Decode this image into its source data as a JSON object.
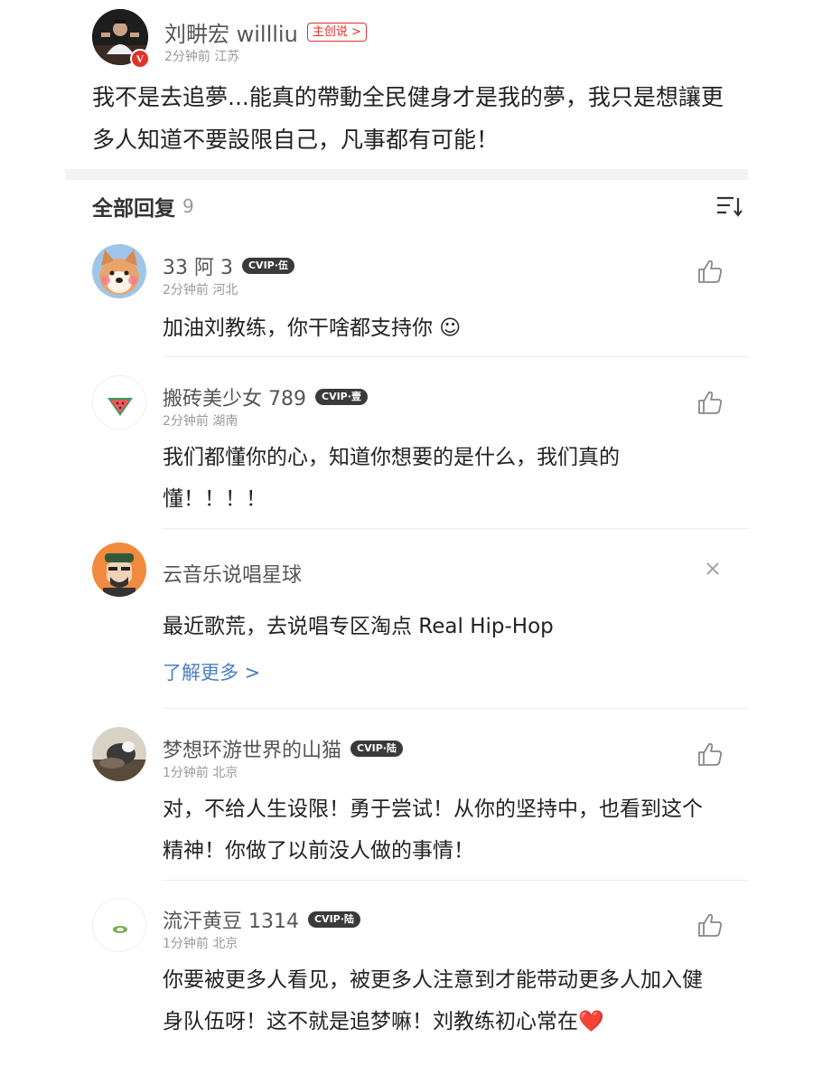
{
  "post": {
    "author": "刘畊宏 willliu",
    "creator_tag": "主创说 >",
    "verified_mark": "V",
    "meta": "2分钟前  江苏",
    "body": "我不是去追夢...能真的帶動全民健身才是我的夢，我只是想讓更多人知道不要設限自己，凡事都有可能！"
  },
  "replies": {
    "title": "全部回复",
    "count": "9",
    "sort_icon": "sort-icon"
  },
  "comments": [
    {
      "name": "33 阿 3",
      "vip": "CVIP·伍",
      "meta": "2分钟前  河北",
      "text": "加油刘教练，你干啥都支持你 ☺",
      "avatar_icon": "shiba-dog-avatar"
    },
    {
      "name": "搬砖美少女 789",
      "vip": "CVIP·壹",
      "meta": "2分钟前  湖南",
      "text": "我们都懂你的心，知道你想要的是什么，我们真的懂！！！！",
      "avatar_icon": "watermelon-avatar"
    },
    {
      "name": "梦想环游世界的山猫",
      "vip": "CVIP·陆",
      "meta": "1分钟前  北京",
      "text": "对，不给人生设限！勇于尝试！从你的坚持中，也看到这个精神！你做了以前没人做的事情！",
      "avatar_icon": "cat-photo-avatar"
    },
    {
      "name": "流汗黄豆 1314",
      "vip": "CVIP·陆",
      "meta": "1分钟前  北京",
      "text": "你要被更多人看见，被更多人注意到才能带动更多人加入健身队伍呀！这不就是追梦嘛！刘教练初心常在❤️",
      "avatar_icon": "bean-avatar"
    }
  ],
  "ad": {
    "name": "云音乐说唱星球",
    "text": "最近歌荒，去说唱专区淘点 Real Hip-Hop",
    "link": "了解更多 >"
  },
  "colors": {
    "creator_red": "#e0322b",
    "link_blue": "#4a7fc1",
    "vip_dark": "#3a3a3a"
  }
}
